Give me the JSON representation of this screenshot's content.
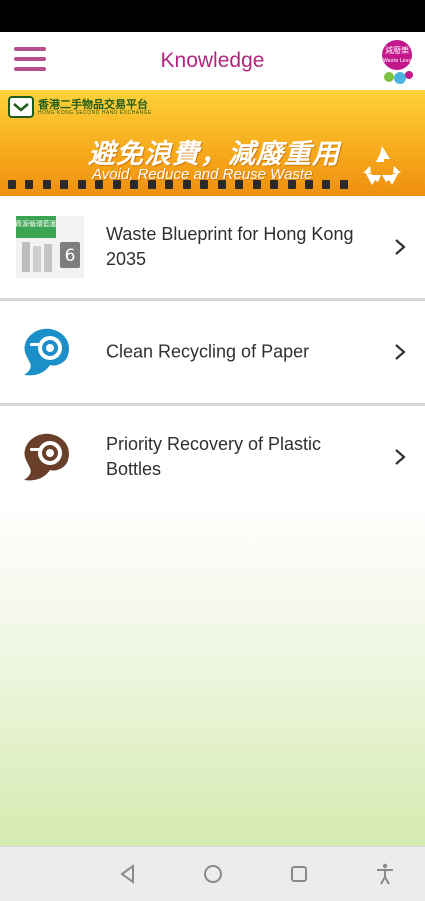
{
  "header": {
    "title": "Knowledge"
  },
  "logo": {
    "text_cn": "減廢樂",
    "text_en": "Waste Less"
  },
  "banner": {
    "org_cn": "香港二手物品交易平台",
    "org_en": "HONG KONG SECOND HAND EXCHANGE",
    "slogan_cn": "避免浪費，減廢重用",
    "slogan_en": "Avoid, Reduce and Reuse Waste"
  },
  "items": [
    {
      "label": "Waste Blueprint for Hong Kong 2035",
      "thumb_text_cn": "資源循環藍圖",
      "thumb_badge": "6",
      "icon": "blueprint-cover-icon"
    },
    {
      "label": "Clean Recycling of Paper",
      "icon": "paper-recycling-icon"
    },
    {
      "label": "Priority Recovery of Plastic Bottles",
      "icon": "plastic-bottle-recycling-icon"
    }
  ],
  "colors": {
    "accent": "#b4257f",
    "banner_yellow": "#f6a91b",
    "paper_blue": "#1b8fc7",
    "bottle_brown": "#6a3f2a"
  },
  "nav": {
    "icons": [
      "back-icon",
      "home-icon",
      "recents-icon",
      "accessibility-icon"
    ]
  }
}
